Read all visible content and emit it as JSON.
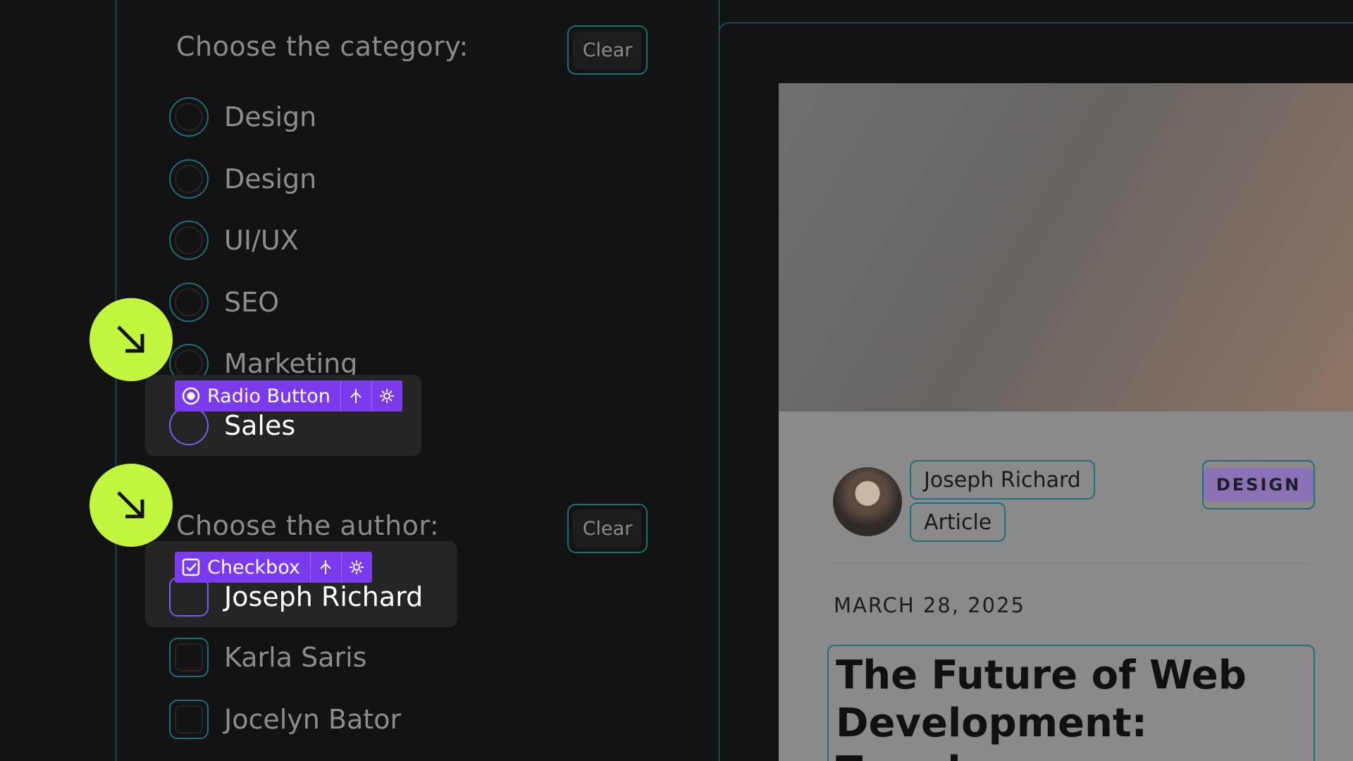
{
  "category": {
    "title": "Choose the category:",
    "clear_label": "Clear",
    "options": [
      "Design",
      "Design",
      "UI/UX",
      "SEO",
      "Marketing",
      "Sales"
    ]
  },
  "author": {
    "title": "Choose the author:",
    "clear_label": "Clear",
    "options": [
      "Joseph Richard",
      "Karla Saris",
      "Jocelyn Bator"
    ]
  },
  "tags": {
    "radio": "Radio Button",
    "checkbox": "Checkbox"
  },
  "colors": {
    "accent_purple": "#7c3aed",
    "guide_teal": "#1f6f78",
    "arrow_lime": "#c2f53d"
  },
  "card": {
    "author": "Joseph Richard",
    "type": "Article",
    "badge": "DESIGN",
    "date": "MARCH 28, 2025",
    "title": "The Future of Web Development: Trends"
  }
}
